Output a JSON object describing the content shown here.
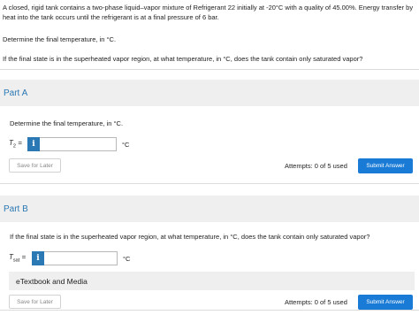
{
  "problem": {
    "statement": "A closed, rigid tank contains a two-phase liquid–vapor mixture of Refrigerant 22 initially at -20°C with a quality of 45.00%. Energy transfer by heat into the tank occurs until the refrigerant is at a final pressure of 6 bar.",
    "task_a": "Determine the final temperature, in °C.",
    "task_b": "If the final state is in the superheated vapor region, at what temperature, in °C, does the tank contain only saturated vapor?"
  },
  "part_a": {
    "title": "Part A",
    "question": "Determine the final temperature, in °C.",
    "var_main": "T",
    "var_sub": "2",
    "equals": "=",
    "info_label": "i",
    "value": "",
    "unit": "°C",
    "save_label": "Save for Later",
    "attempts": "Attempts: 0 of 5 used",
    "submit_label": "Submit Answer"
  },
  "part_b": {
    "title": "Part B",
    "question": "If the final state is in the superheated vapor region, at what temperature, in °C, does the tank contain only saturated vapor?",
    "var_main": "T",
    "var_sub": "sat",
    "equals": "=",
    "info_label": "i",
    "value": "",
    "unit": "°C",
    "etextbook_label": "eTextbook and Media",
    "save_label": "Save for Later",
    "attempts": "Attempts: 0 of 5 used",
    "submit_label": "Submit Answer"
  },
  "colors": {
    "accent_blue": "#2a78b4",
    "submit_blue": "#1a7bd6",
    "band_gray": "#efefef"
  }
}
